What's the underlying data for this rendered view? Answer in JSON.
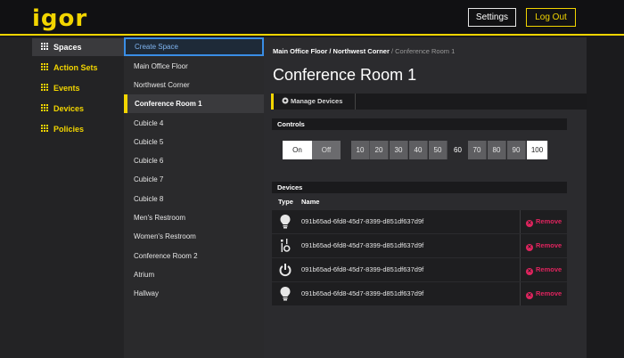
{
  "app": {
    "logo": "igor",
    "settings_label": "Settings",
    "logout_label": "Log Out",
    "accent_color": "#f2d500"
  },
  "nav": {
    "items": [
      {
        "label": "Spaces",
        "icon": "grid-icon",
        "active": true
      },
      {
        "label": "Action Sets",
        "icon": "grid-icon"
      },
      {
        "label": "Events",
        "icon": "grid-icon"
      },
      {
        "label": "Devices",
        "icon": "grid-icon"
      },
      {
        "label": "Policies",
        "icon": "grid-icon"
      }
    ]
  },
  "spaces": {
    "create_label": "Create Space",
    "items": [
      {
        "label": "Main Office Floor"
      },
      {
        "label": "Northwest Corner"
      },
      {
        "label": "Conference Room 1",
        "selected": true
      },
      {
        "label": "Cubicle 4"
      },
      {
        "label": "Cubicle 5"
      },
      {
        "label": "Cubicle 6"
      },
      {
        "label": "Cubicle 7"
      },
      {
        "label": "Cubicle 8"
      },
      {
        "label": "Men's Restroom"
      },
      {
        "label": "Women's Restroom"
      },
      {
        "label": "Conference Room 2"
      },
      {
        "label": "Atrium"
      },
      {
        "label": "Hallway"
      }
    ]
  },
  "main": {
    "breadcrumb": {
      "crumb1": "Main Office Floor",
      "sep1": " / ",
      "crumb2": "Northwest Corner",
      "sep2": " / ",
      "current": "Conference Room 1"
    },
    "title": "Conference Room 1",
    "tab_manage": "Manage Devices",
    "controls": {
      "heading": "Controls",
      "on_label": "On",
      "off_label": "Off",
      "levels": [
        "10",
        "20",
        "30",
        "40",
        "50",
        "60",
        "70",
        "80",
        "90",
        "100"
      ],
      "selected_level": "100"
    },
    "devices": {
      "heading": "Devices",
      "col_type": "Type",
      "col_name": "Name",
      "remove_label": "Remove",
      "remove_color": "#e0245e",
      "rows": [
        {
          "type_icon": "lightbulb-icon",
          "name": "091b65ad-6fd8-45d7-8399-d851df637d9f"
        },
        {
          "type_icon": "sensor-icon",
          "name": "091b65ad-6fd8-45d7-8399-d851df637d9f"
        },
        {
          "type_icon": "power-icon",
          "name": "091b65ad-6fd8-45d7-8399-d851df637d9f"
        },
        {
          "type_icon": "lightbulb-icon",
          "name": "091b65ad-6fd8-45d7-8399-d851df637d9f"
        }
      ]
    }
  }
}
